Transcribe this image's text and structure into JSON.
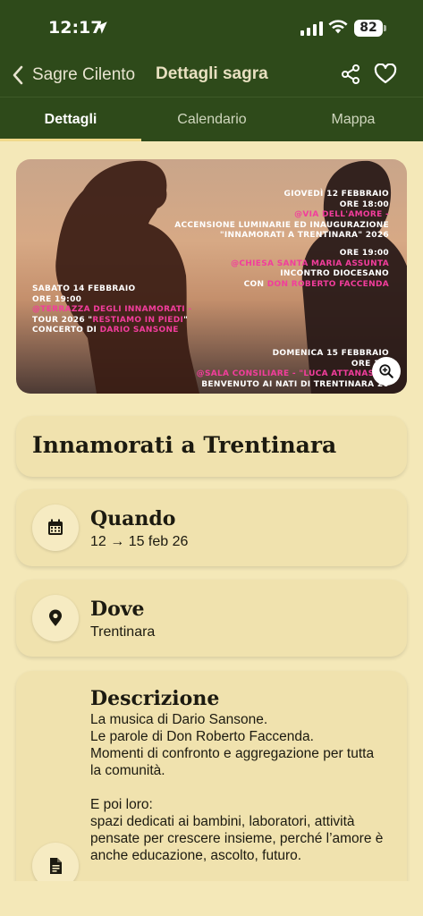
{
  "status": {
    "time": "12:17",
    "battery": "82"
  },
  "nav": {
    "back_label": "Sagre Cilento",
    "title": "Dettagli sagra"
  },
  "tabs": [
    {
      "label": "Dettagli"
    },
    {
      "label": "Calendario"
    },
    {
      "label": "Mappa"
    }
  ],
  "poster": {
    "event1": [
      "GIOVEDÌ 12 FEBBRAIO",
      "ORE 18:00",
      "@VIA DELL'AMORE -",
      "ACCENSIONE LUMINARIE ED INAUGURAZIONE",
      "\"INNAMORATI A TRENTINARA\" 2026"
    ],
    "event2": [
      "ORE 19:00",
      "@CHIESA SANTA MARIA ASSUNTA",
      "INCONTRO DIOCESANO",
      "CON",
      "DON ROBERTO FACCENDA"
    ],
    "event3": [
      "SABATO 14 FEBBRAIO",
      "ORE 19:00",
      "@TERRAZZA DEGLI INNAMORATI -",
      "TOUR 2026 \"",
      "RESTIAMO IN PIEDI",
      "\"",
      "CONCERTO DI",
      "DARIO SANSONE"
    ],
    "event4": [
      "DOMENICA 15 FEBBRAIO",
      "ORE 17:",
      "@SALA CONSILIARE - \"LUCA ATTANASIO\"",
      "BENVENUTO AI NATI DI TRENTINARA 20"
    ]
  },
  "event": {
    "name": "Innamorati a Trentinara",
    "when_label": "Quando",
    "when_value": "12 → 15 feb 26",
    "where_label": "Dove",
    "where_value": "Trentinara",
    "description_label": "Descrizione",
    "description_text": "La musica di Dario Sansone.\nLe parole di Don Roberto Faccenda.\nMomenti di confronto e aggregazione per tutta la comunità.\n\nE poi loro:\nspazi dedicati ai bambini, laboratori, attività pensate per crescere insieme, perché l’amore è anche educazione, ascolto, futuro."
  },
  "colors": {
    "header": "#2e4a1a",
    "background": "#f4e8b8",
    "card": "#f0e2ae",
    "accent_pink": "#f23d9c"
  },
  "icons": [
    "location-arrow-icon",
    "signal-icon",
    "wifi-icon",
    "chevron-left-icon",
    "share-icon",
    "heart-icon",
    "zoom-in-icon",
    "calendar-icon",
    "map-pin-icon",
    "document-icon"
  ]
}
